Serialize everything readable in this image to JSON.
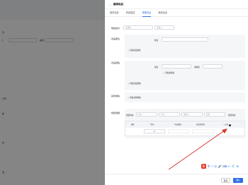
{
  "background": {
    "texts": [
      {
        "text": "号"
      },
      {
        "text": "t"
      },
      {
        "text": "品牌"
      },
      {
        "text": "行号"
      },
      {
        "text": "类"
      },
      {
        "text": "态"
      },
      {
        "text": "选"
      }
    ]
  },
  "drawer": {
    "title": "编辑商品",
    "back_icon": "‹",
    "tabs": [
      {
        "label": "基本信息"
      },
      {
        "label": "商品描述"
      },
      {
        "label": "规格信息"
      },
      {
        "label": "其他信息"
      }
    ],
    "spec_mode": {
      "label": "规格模式",
      "value": "多规格",
      "extra_placeholder": "请输入"
    },
    "section1": {
      "label": "商品属性",
      "field_label": "属性",
      "add_link": "添加商品属性"
    },
    "section2": {
      "label": "商品规格",
      "field_label": "属性",
      "field_label2": "规格值",
      "add_value_link": "添加规格值",
      "add_link": "添加商品规格"
    },
    "section3": {
      "label": "其他规格",
      "add_link": "添加其他规格"
    },
    "batch": {
      "label": "规格明细",
      "row_label": "批量填充",
      "placeholders": [
        "售价",
        "库存",
        "成本价",
        "重量"
      ],
      "fill_button": "批量填充"
    },
    "table": {
      "headers": [
        "属性",
        "* 售价",
        "* 商品编号",
        "商品条形码",
        "一口价"
      ],
      "row": {
        "price": "0"
      }
    },
    "footer": {
      "cancel": "取消",
      "ok": "确认"
    }
  },
  "ime": {
    "logo": "S",
    "icons": [
      "中",
      "•",
      "☺",
      "🎤",
      "⌨",
      "✂",
      "👕",
      "⊞"
    ]
  },
  "annotation": {
    "color": "#d9342b"
  }
}
